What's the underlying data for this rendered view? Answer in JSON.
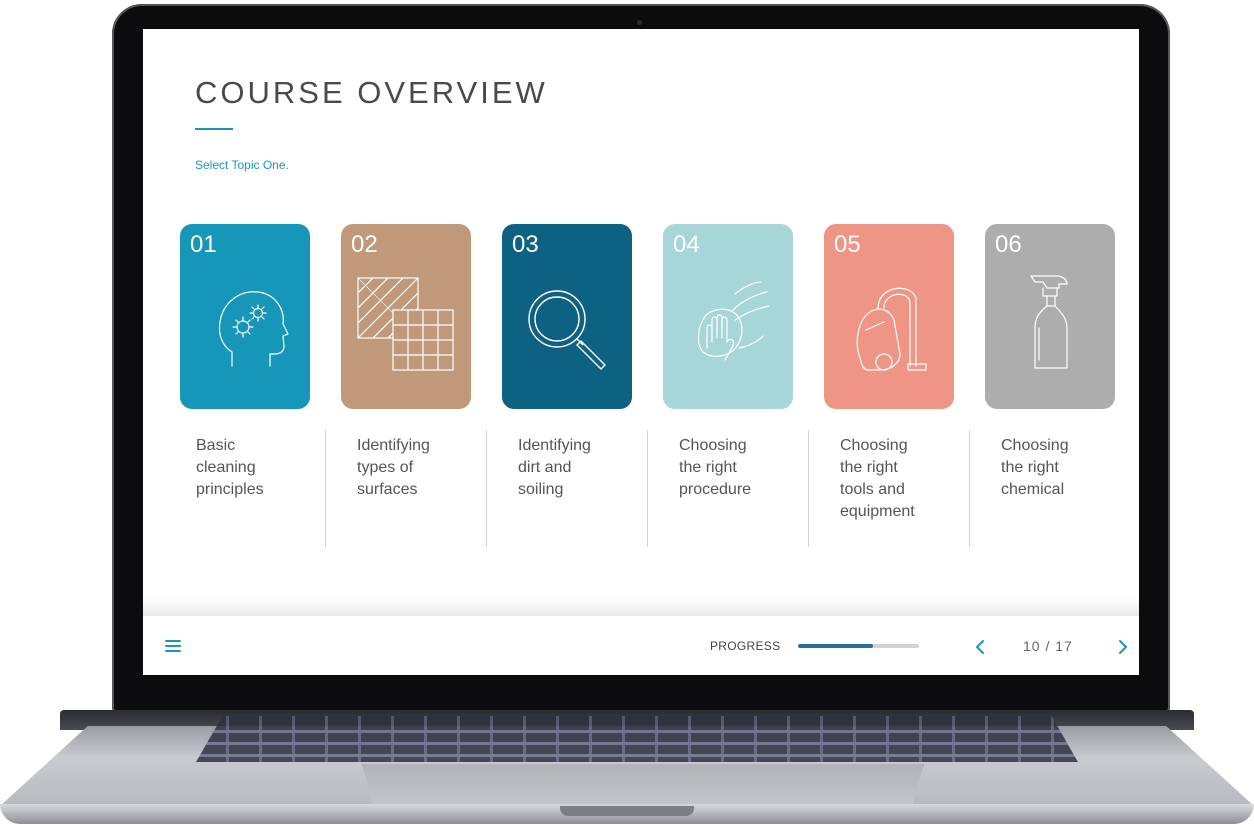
{
  "page": {
    "title": "COURSE OVERVIEW",
    "instruction": "Select Topic One."
  },
  "topics": [
    {
      "number": "01",
      "label": "Basic\ncleaning\nprinciples",
      "color": "#1696b9",
      "icon": "head-gears-icon"
    },
    {
      "number": "02",
      "label": "Identifying\ntypes of\nsurfaces",
      "color": "#c0997b",
      "icon": "tiles-icon"
    },
    {
      "number": "03",
      "label": "Identifying\ndirt and\nsoiling",
      "color": "#0d6182",
      "icon": "magnifier-icon"
    },
    {
      "number": "04",
      "label": "Choosing\nthe right\nprocedure",
      "color": "#a6d6d8",
      "icon": "wiping-hand-icon"
    },
    {
      "number": "05",
      "label": "Choosing\nthe right\ntools and\nequipment",
      "color": "#ef9585",
      "icon": "vacuum-cleaner-icon"
    },
    {
      "number": "06",
      "label": "Choosing\nthe right\nchemical",
      "color": "#adadad",
      "icon": "spray-bottle-icon"
    }
  ],
  "footer": {
    "menu_icon": "hamburger-menu-icon",
    "progress_label": "PROGRESS",
    "progress_fraction": 0.62,
    "prev_icon": "chevron-left-icon",
    "next_icon": "chevron-right-icon",
    "page_count": "10 / 17",
    "accent": "#1996b8"
  }
}
